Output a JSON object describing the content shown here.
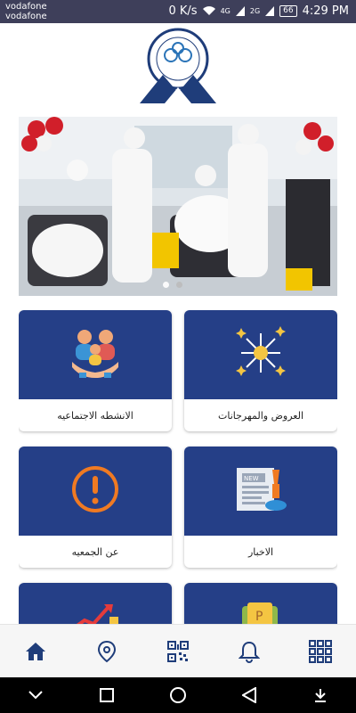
{
  "status_bar": {
    "carrier_1": "vodafone",
    "carrier_2": "vodafone",
    "net_speed": "0 K/s",
    "signal_1": "4G",
    "signal_2": "2G",
    "battery": "66",
    "time": "4:29 PM"
  },
  "logo": {
    "alt": "organization-logo"
  },
  "banner": {
    "slides": 2,
    "active_slide": 0
  },
  "cards": [
    {
      "label": "الانشطه الاجتماعيه",
      "icon": "family-hands-icon"
    },
    {
      "label": "العروض والمهرجانات",
      "icon": "fireworks-icon"
    },
    {
      "label": "عن الجمعيه",
      "icon": "exclamation-icon"
    },
    {
      "label": "الاخبار",
      "icon": "newspaper-icon"
    },
    {
      "label": "",
      "icon": "growth-chart-icon"
    },
    {
      "label": "",
      "icon": "wallet-icon"
    }
  ],
  "bottom_nav": [
    {
      "icon": "home-icon",
      "active": true
    },
    {
      "icon": "location-icon",
      "active": false
    },
    {
      "icon": "qr-code-icon",
      "active": false
    },
    {
      "icon": "bell-icon",
      "active": false
    },
    {
      "icon": "grid-menu-icon",
      "active": false
    }
  ],
  "colors": {
    "card_blue": "#253f87",
    "nav_active": "#1f3d7a",
    "status_bar": "#3e3f5a"
  }
}
